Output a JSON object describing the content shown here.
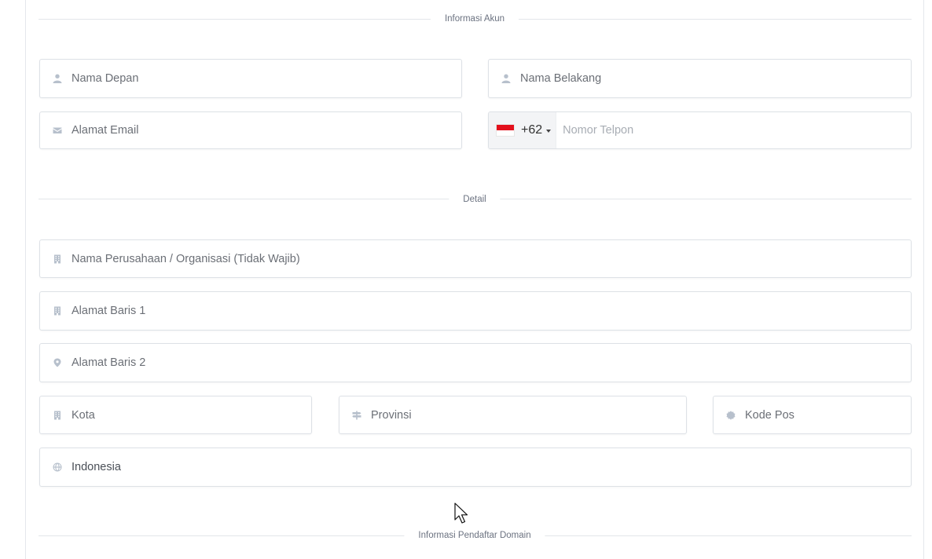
{
  "sections": {
    "account": "Informasi Akun",
    "detail": "Detail",
    "registrant": "Informasi Pendaftar Domain"
  },
  "fields": {
    "first_name": {
      "placeholder": "Nama Depan",
      "icon": "user-icon"
    },
    "last_name": {
      "placeholder": "Nama Belakang",
      "icon": "user-icon"
    },
    "email": {
      "placeholder": "Alamat Email",
      "icon": "envelope-icon"
    },
    "phone": {
      "country_code": "+62",
      "flag": "indonesia-flag",
      "placeholder": "Nomor Telpon"
    },
    "company": {
      "placeholder": "Nama Perusahaan / Organisasi (Tidak Wajib)",
      "icon": "building-icon"
    },
    "address1": {
      "placeholder": "Alamat Baris 1",
      "icon": "building-icon"
    },
    "address2": {
      "placeholder": "Alamat Baris 2",
      "icon": "map-marker-icon"
    },
    "city": {
      "placeholder": "Kota",
      "icon": "building-icon"
    },
    "state": {
      "placeholder": "Provinsi",
      "icon": "signpost-icon"
    },
    "postcode": {
      "placeholder": "Kode Pos",
      "icon": "badge-icon"
    },
    "country": {
      "value": "Indonesia",
      "icon": "globe-icon"
    }
  },
  "colors": {
    "flag_red": "#e3101c",
    "icon": "#b7c0cc",
    "border": "#dde1e6"
  }
}
